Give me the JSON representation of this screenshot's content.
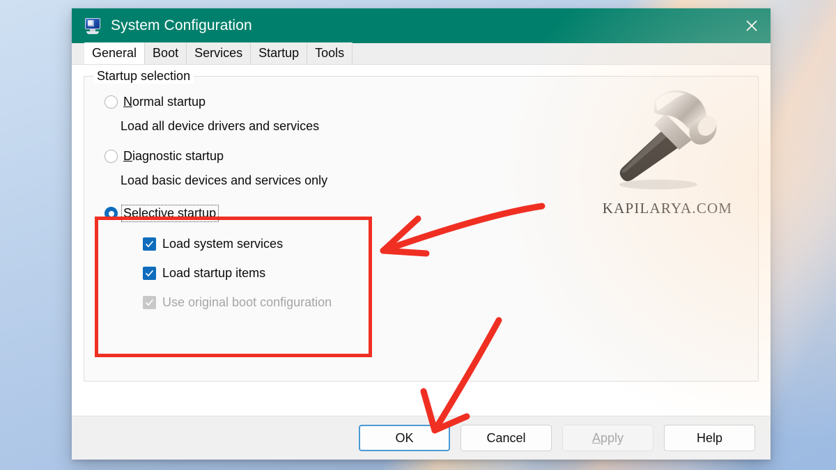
{
  "window": {
    "title": "System Configuration",
    "app_icon": "system-configuration-icon",
    "close_icon": "close-icon",
    "titlebar_color": "#00806c"
  },
  "tabs": [
    {
      "label": "General",
      "active": true
    },
    {
      "label": "Boot",
      "active": false
    },
    {
      "label": "Services",
      "active": false
    },
    {
      "label": "Startup",
      "active": false
    },
    {
      "label": "Tools",
      "active": false
    }
  ],
  "groupbox": {
    "legend": "Startup selection"
  },
  "startup_options": [
    {
      "id": "normal-startup",
      "accesskey": "N",
      "label_before": "",
      "label_after": "ormal startup",
      "full_label": "Normal startup",
      "selected": false,
      "description": "Load all device drivers and services"
    },
    {
      "id": "diagnostic-startup",
      "accesskey": "D",
      "label_before": "",
      "label_after": "iagnostic startup",
      "full_label": "Diagnostic startup",
      "selected": false,
      "description": "Load basic devices and services only"
    },
    {
      "id": "selective-startup",
      "accesskey": "S",
      "label_before": "",
      "label_after": "elective startup",
      "full_label": "Selective startup",
      "selected": true,
      "focused": true,
      "description": ""
    }
  ],
  "selective_checkboxes": [
    {
      "id": "load-system-services",
      "accesskey": "L",
      "label_after": "oad system services",
      "full_label": "Load system services",
      "checked": true,
      "disabled": false
    },
    {
      "id": "load-startup-items",
      "accesskey": "L",
      "label_after": "oad startup items",
      "full_label": "Load startup items",
      "checked": true,
      "disabled": false
    },
    {
      "id": "use-original-boot-configuration",
      "accesskey": "U",
      "label_after": "se original boot configuration",
      "full_label": "Use original boot configuration",
      "checked": true,
      "disabled": true
    }
  ],
  "watermark": {
    "image": "hammer-icon",
    "text": "KAPILARYA.COM"
  },
  "buttons": [
    {
      "id": "ok",
      "label": "OK",
      "accesskey": "",
      "label_after": "OK",
      "focused": true,
      "disabled": false
    },
    {
      "id": "cancel",
      "label": "Cancel",
      "accesskey": "",
      "label_after": "Cancel",
      "focused": false,
      "disabled": false
    },
    {
      "id": "apply",
      "label": "Apply",
      "accesskey": "A",
      "label_after": "pply",
      "focused": false,
      "disabled": true
    },
    {
      "id": "help",
      "label": "Help",
      "accesskey": "",
      "label_after": "Help",
      "focused": false,
      "disabled": false
    }
  ],
  "annotations": {
    "highlight_color": "#f02f23",
    "rect_target": "selective-startup-group",
    "arrow_1_target": "selective-startup-group",
    "arrow_2_target": "ok-button"
  }
}
